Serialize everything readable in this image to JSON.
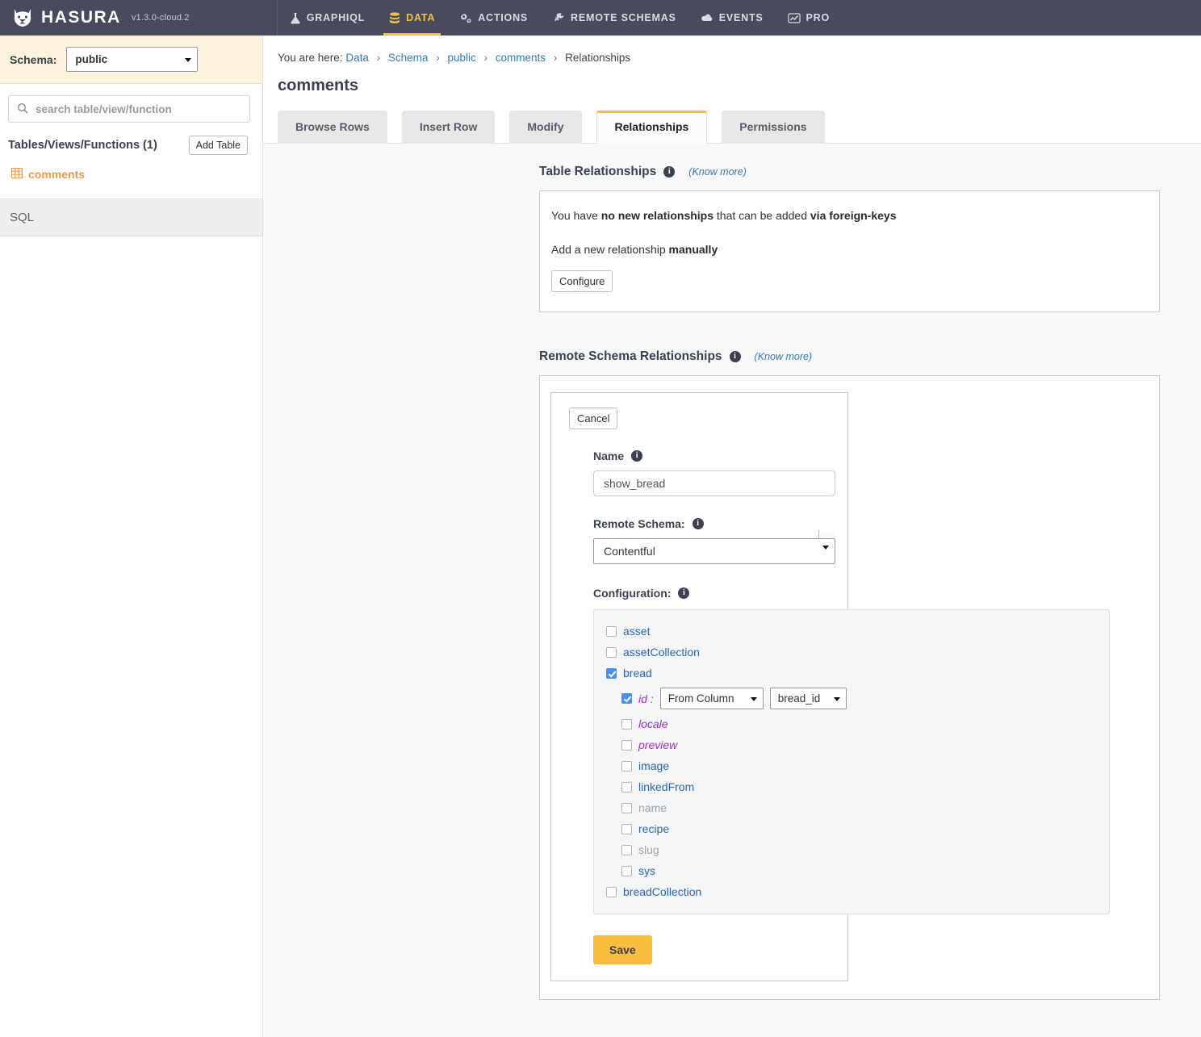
{
  "topnav": {
    "brand": "HASURA",
    "version": "v1.3.0-cloud.2",
    "items": [
      {
        "label": "GRAPHIQL",
        "icon": "flask-icon",
        "active": false
      },
      {
        "label": "DATA",
        "icon": "database-icon",
        "active": true
      },
      {
        "label": "ACTIONS",
        "icon": "gears-icon",
        "active": false
      },
      {
        "label": "REMOTE SCHEMAS",
        "icon": "plug-icon",
        "active": false
      },
      {
        "label": "EVENTS",
        "icon": "cloud-icon",
        "active": false
      },
      {
        "label": "PRO",
        "icon": "chart-line-icon",
        "active": false
      }
    ]
  },
  "sidebar": {
    "schema_label": "Schema:",
    "schema_value": "public",
    "search_placeholder": "search table/view/function",
    "search_value": "",
    "tvf_title": "Tables/Views/Functions (1)",
    "add_table_label": "Add Table",
    "tables": [
      {
        "name": "comments",
        "icon": "table-grid-icon"
      }
    ],
    "sql_label": "SQL"
  },
  "breadcrumb": {
    "prefix": "You are here:",
    "items": [
      "Data",
      "Schema",
      "public",
      "comments",
      "Relationships"
    ],
    "separator": "›"
  },
  "page": {
    "title": "comments",
    "tabs": [
      {
        "label": "Browse Rows",
        "active": false
      },
      {
        "label": "Insert Row",
        "active": false
      },
      {
        "label": "Modify",
        "active": false
      },
      {
        "label": "Relationships",
        "active": true
      },
      {
        "label": "Permissions",
        "active": false
      }
    ]
  },
  "table_relationships": {
    "title": "Table Relationships",
    "know_more": "(Know more)",
    "line1_a": "You have ",
    "line1_b": "no new relationships",
    "line1_c": " that can be added ",
    "line1_d": "via foreign-keys",
    "line2_a": "Add a new relationship ",
    "line2_b": "manually",
    "configure_label": "Configure"
  },
  "remote_schema_relationships": {
    "title": "Remote Schema Relationships",
    "know_more": "(Know more)",
    "cancel_label": "Cancel",
    "name_label": "Name",
    "name_value": "show_bread",
    "remote_schema_label": "Remote Schema:",
    "remote_schema_value": "Contentful",
    "configuration_label": "Configuration:",
    "save_label": "Save",
    "tree": [
      {
        "label": "asset",
        "checked": false,
        "indent": 0,
        "kind": "type"
      },
      {
        "label": "assetCollection",
        "checked": false,
        "indent": 0,
        "kind": "type"
      },
      {
        "label": "bread",
        "checked": true,
        "indent": 0,
        "kind": "type"
      },
      {
        "label": "id :",
        "checked": true,
        "indent": 1,
        "kind": "arg",
        "source_value": "From Column",
        "column_value": "bread_id"
      },
      {
        "label": "locale",
        "checked": false,
        "indent": 1,
        "kind": "arg"
      },
      {
        "label": "preview",
        "checked": false,
        "indent": 1,
        "kind": "arg"
      },
      {
        "label": "image",
        "checked": false,
        "indent": 1,
        "kind": "type"
      },
      {
        "label": "linkedFrom",
        "checked": false,
        "indent": 1,
        "kind": "type"
      },
      {
        "label": "name",
        "checked": false,
        "indent": 1,
        "kind": "scalar"
      },
      {
        "label": "recipe",
        "checked": false,
        "indent": 1,
        "kind": "type"
      },
      {
        "label": "slug",
        "checked": false,
        "indent": 1,
        "kind": "scalar"
      },
      {
        "label": "sys",
        "checked": false,
        "indent": 1,
        "kind": "type"
      },
      {
        "label": "breadCollection",
        "checked": false,
        "indent": 0,
        "kind": "type"
      }
    ]
  },
  "colors": {
    "nav_bg": "#484b5d",
    "accent_yellow": "#f5bf42",
    "link_blue": "#337ab7",
    "table_orange": "#f0984b",
    "checkbox_blue": "#4a8ef0",
    "schema_bg": "#fcf3dd",
    "content_bg": "#f8f9fb"
  }
}
